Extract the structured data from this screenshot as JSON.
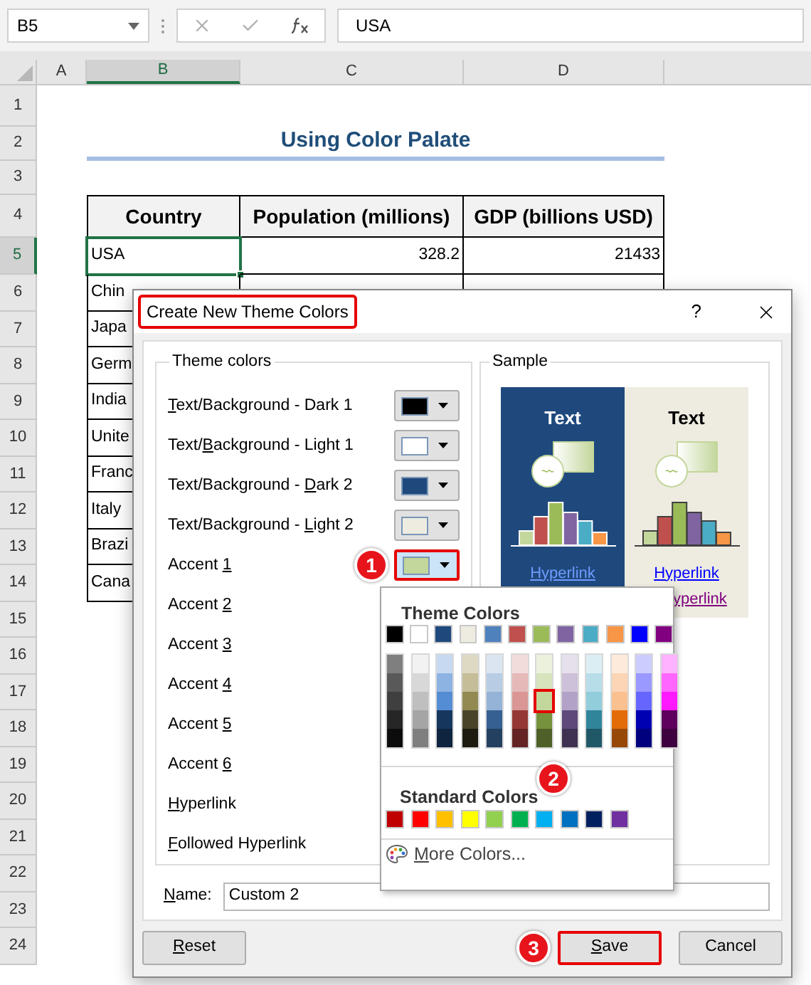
{
  "formula_bar": {
    "name_box": "B5",
    "formula": "USA"
  },
  "columns": [
    {
      "label": "A",
      "selected": false
    },
    {
      "label": "B",
      "selected": true
    },
    {
      "label": "C",
      "selected": false
    },
    {
      "label": "D",
      "selected": false
    }
  ],
  "row_headers": [
    {
      "label": "1",
      "selected": false
    },
    {
      "label": "2",
      "selected": false
    },
    {
      "label": "3",
      "selected": false
    },
    {
      "label": "4",
      "selected": false
    },
    {
      "label": "5",
      "selected": true
    },
    {
      "label": "6",
      "selected": false
    },
    {
      "label": "7",
      "selected": false
    },
    {
      "label": "8",
      "selected": false
    },
    {
      "label": "9",
      "selected": false
    },
    {
      "label": "10",
      "selected": false
    },
    {
      "label": "11",
      "selected": false
    },
    {
      "label": "12",
      "selected": false
    },
    {
      "label": "13",
      "selected": false
    },
    {
      "label": "14",
      "selected": false
    },
    {
      "label": "15",
      "selected": false
    },
    {
      "label": "16",
      "selected": false
    },
    {
      "label": "17",
      "selected": false
    },
    {
      "label": "18",
      "selected": false
    },
    {
      "label": "19",
      "selected": false
    },
    {
      "label": "20",
      "selected": false
    },
    {
      "label": "21",
      "selected": false
    },
    {
      "label": "22",
      "selected": false
    },
    {
      "label": "23",
      "selected": false
    },
    {
      "label": "24",
      "selected": false
    }
  ],
  "sheet": {
    "title": "Using Color Palate",
    "headers": [
      "Country",
      "Population (millions)",
      "GDP (billions USD)"
    ],
    "rows": [
      {
        "cells": [
          "USA",
          "328.2",
          "21433"
        ],
        "active": true
      },
      {
        "cells": [
          "Chin"
        ],
        "active": false
      },
      {
        "cells": [
          "Japa"
        ],
        "active": false
      },
      {
        "cells": [
          "Germ"
        ],
        "active": false
      },
      {
        "cells": [
          "India"
        ],
        "active": false
      },
      {
        "cells": [
          "Unite"
        ],
        "active": false
      },
      {
        "cells": [
          "Franc"
        ],
        "active": false
      },
      {
        "cells": [
          "Italy"
        ],
        "active": false
      },
      {
        "cells": [
          "Brazi"
        ],
        "active": false
      },
      {
        "cells": [
          "Cana"
        ],
        "active": false
      }
    ]
  },
  "dialog": {
    "title": "Create New Theme Colors",
    "title_highlighted": true,
    "help": "?",
    "theme_group": {
      "legend": "Theme colors",
      "items": [
        {
          "key": "T",
          "post": "ext/Background - Dark 1",
          "color": "#000000",
          "expanded": false,
          "highlighted": false
        },
        {
          "pre": "Text/",
          "key": "B",
          "post": "ackground - Light 1",
          "color": "#ffffff",
          "expanded": false,
          "highlighted": false
        },
        {
          "pre": "Text/Background - ",
          "key": "D",
          "post": "ark 2",
          "color": "#1f497d",
          "expanded": false,
          "highlighted": false
        },
        {
          "pre": "Text/Background - ",
          "key": "L",
          "post": "ight 2",
          "color": "#eeece1",
          "expanded": false,
          "highlighted": false
        },
        {
          "pre": "Accent ",
          "key": "1",
          "color": "#c3d69b",
          "expanded": true,
          "highlighted": true,
          "callout": "1"
        },
        {
          "pre": "Accent ",
          "key": "2"
        },
        {
          "pre": "Accent ",
          "key": "3"
        },
        {
          "pre": "Accent ",
          "key": "4"
        },
        {
          "pre": "Accent ",
          "key": "5"
        },
        {
          "pre": "Accent ",
          "key": "6"
        },
        {
          "key": "H",
          "post": "yperlink"
        },
        {
          "key": "F",
          "post": "ollowed Hyperlink"
        }
      ]
    },
    "sample": {
      "legend": "Sample",
      "panels": [
        {
          "kind": "dark",
          "text": "Text",
          "hyperlink": "Hyperlink"
        },
        {
          "kind": "light",
          "text": "Text",
          "hyperlink": "Hyperlink",
          "followed": "yperlink"
        }
      ]
    },
    "palette": {
      "callout": "2",
      "theme_title": "Theme Colors",
      "base": [
        {
          "color": "#000000",
          "selected": false
        },
        {
          "color": "#ffffff",
          "selected": false
        },
        {
          "color": "#1f497d",
          "selected": false
        },
        {
          "color": "#eeece1",
          "selected": false
        },
        {
          "color": "#4f81bd",
          "selected": false
        },
        {
          "color": "#c0504d",
          "selected": false
        },
        {
          "color": "#9bbb59",
          "selected": false
        },
        {
          "color": "#8064a2",
          "selected": false
        },
        {
          "color": "#4bacc6",
          "selected": false
        },
        {
          "color": "#f79646",
          "selected": false
        },
        {
          "color": "#0000ff",
          "selected": false
        },
        {
          "color": "#800080",
          "selected": false
        }
      ],
      "shades": [
        {
          "swatches": [
            {
              "color": "#7f7f7f",
              "selected": false
            },
            {
              "color": "#595959",
              "selected": false
            },
            {
              "color": "#3f3f3f",
              "selected": false
            },
            {
              "color": "#262626",
              "selected": false
            },
            {
              "color": "#0c0c0c",
              "selected": false
            }
          ]
        },
        {
          "swatches": [
            {
              "color": "#f2f2f2",
              "selected": false
            },
            {
              "color": "#d8d8d8",
              "selected": false
            },
            {
              "color": "#bfbfbf",
              "selected": false
            },
            {
              "color": "#a5a5a5",
              "selected": false
            },
            {
              "color": "#7f7f7f",
              "selected": false
            }
          ]
        },
        {
          "swatches": [
            {
              "color": "#c6d9f0",
              "selected": false
            },
            {
              "color": "#8db3e2",
              "selected": false
            },
            {
              "color": "#548dd4",
              "selected": false
            },
            {
              "color": "#17365d",
              "selected": false
            },
            {
              "color": "#0f243e",
              "selected": false
            }
          ]
        },
        {
          "swatches": [
            {
              "color": "#ddd9c3",
              "selected": false
            },
            {
              "color": "#c4bd97",
              "selected": false
            },
            {
              "color": "#938953",
              "selected": false
            },
            {
              "color": "#494429",
              "selected": false
            },
            {
              "color": "#1d1b10",
              "selected": false
            }
          ]
        },
        {
          "swatches": [
            {
              "color": "#dbe5f1",
              "selected": false
            },
            {
              "color": "#b8cce4",
              "selected": false
            },
            {
              "color": "#95b3d7",
              "selected": false
            },
            {
              "color": "#366092",
              "selected": false
            },
            {
              "color": "#244061",
              "selected": false
            }
          ]
        },
        {
          "swatches": [
            {
              "color": "#f2dcdb",
              "selected": false
            },
            {
              "color": "#e5b9b7",
              "selected": false
            },
            {
              "color": "#d99694",
              "selected": false
            },
            {
              "color": "#953734",
              "selected": false
            },
            {
              "color": "#632423",
              "selected": false
            }
          ]
        },
        {
          "swatches": [
            {
              "color": "#ebf1dd",
              "selected": false
            },
            {
              "color": "#d7e3bc",
              "selected": false
            },
            {
              "color": "#c3d69b",
              "selected": true
            },
            {
              "color": "#76923c",
              "selected": false
            },
            {
              "color": "#4f6128",
              "selected": false
            }
          ]
        },
        {
          "swatches": [
            {
              "color": "#e5e0ec",
              "selected": false
            },
            {
              "color": "#ccc1d9",
              "selected": false
            },
            {
              "color": "#b2a2c7",
              "selected": false
            },
            {
              "color": "#5f497a",
              "selected": false
            },
            {
              "color": "#3f3151",
              "selected": false
            }
          ]
        },
        {
          "swatches": [
            {
              "color": "#dbeef3",
              "selected": false
            },
            {
              "color": "#b7dde8",
              "selected": false
            },
            {
              "color": "#92cddc",
              "selected": false
            },
            {
              "color": "#31859b",
              "selected": false
            },
            {
              "color": "#205867",
              "selected": false
            }
          ]
        },
        {
          "swatches": [
            {
              "color": "#fdeada",
              "selected": false
            },
            {
              "color": "#fbd5b5",
              "selected": false
            },
            {
              "color": "#fac08f",
              "selected": false
            },
            {
              "color": "#e36c09",
              "selected": false
            },
            {
              "color": "#974806",
              "selected": false
            }
          ]
        },
        {
          "swatches": [
            {
              "color": "#ccccff",
              "selected": false
            },
            {
              "color": "#9999ff",
              "selected": false
            },
            {
              "color": "#6666ff",
              "selected": false
            },
            {
              "color": "#0000b2",
              "selected": false
            },
            {
              "color": "#00007f",
              "selected": false
            }
          ]
        },
        {
          "swatches": [
            {
              "color": "#ffb2ff",
              "selected": false
            },
            {
              "color": "#ff66ff",
              "selected": false
            },
            {
              "color": "#ff19ff",
              "selected": false
            },
            {
              "color": "#5f005f",
              "selected": false
            },
            {
              "color": "#3f003f",
              "selected": false
            }
          ]
        }
      ],
      "standard_title": "Standard Colors",
      "standard": [
        {
          "color": "#c00000",
          "selected": false
        },
        {
          "color": "#ff0000",
          "selected": false
        },
        {
          "color": "#ffc000",
          "selected": false
        },
        {
          "color": "#ffff00",
          "selected": false
        },
        {
          "color": "#92d050",
          "selected": false
        },
        {
          "color": "#00b050",
          "selected": false
        },
        {
          "color": "#00b0f0",
          "selected": false
        },
        {
          "color": "#0070c0",
          "selected": false
        },
        {
          "color": "#002060",
          "selected": false
        },
        {
          "color": "#7030a0",
          "selected": false
        }
      ],
      "more": {
        "key": "M",
        "post": "ore Colors..."
      }
    },
    "name": {
      "key": "N",
      "post": "ame:",
      "value": "Custom 2"
    },
    "buttons": [
      {
        "key": "R",
        "post": "eset",
        "highlighted": false
      },
      {
        "key": "S",
        "post": "ave",
        "highlighted": true,
        "callout": "3"
      },
      {
        "pre": "Cancel",
        "highlighted": false
      }
    ]
  }
}
